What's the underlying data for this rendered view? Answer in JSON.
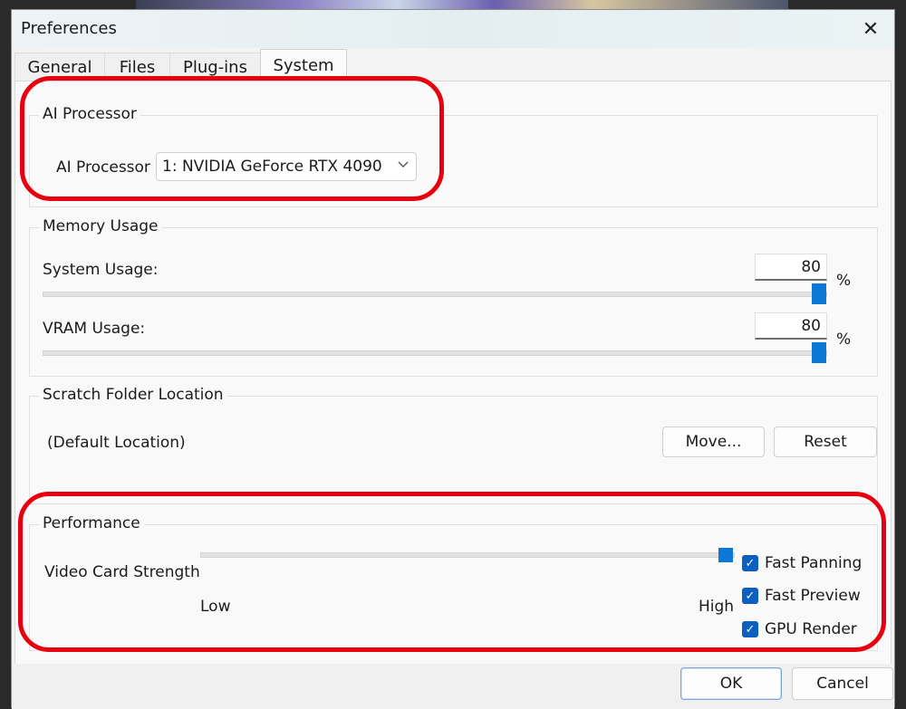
{
  "window": {
    "title": "Preferences"
  },
  "tabs": [
    {
      "label": "General",
      "active": false
    },
    {
      "label": "Files",
      "active": false
    },
    {
      "label": "Plug-ins",
      "active": false
    },
    {
      "label": "System",
      "active": true
    }
  ],
  "ai_processor": {
    "group_label": "AI Processor",
    "field_label": "AI Processor",
    "selected": "1: NVIDIA GeForce RTX 4090"
  },
  "memory": {
    "group_label": "Memory Usage",
    "system_label": "System Usage:",
    "system_value": "80",
    "vram_label": "VRAM Usage:",
    "vram_value": "80",
    "unit": "%"
  },
  "scratch": {
    "group_label": "Scratch Folder Location",
    "location": "(Default Location)",
    "move_label": "Move...",
    "reset_label": "Reset"
  },
  "performance": {
    "group_label": "Performance",
    "strength_label": "Video Card Strength",
    "low_label": "Low",
    "high_label": "High",
    "strength_level": 1.0,
    "checks": [
      {
        "label": "Fast Panning",
        "checked": true
      },
      {
        "label": "Fast Preview",
        "checked": true
      },
      {
        "label": "GPU Render",
        "checked": true
      }
    ]
  },
  "footer": {
    "ok_label": "OK",
    "cancel_label": "Cancel"
  },
  "colors": {
    "accent": "#0a78d4",
    "highlight": "#e8000f"
  }
}
